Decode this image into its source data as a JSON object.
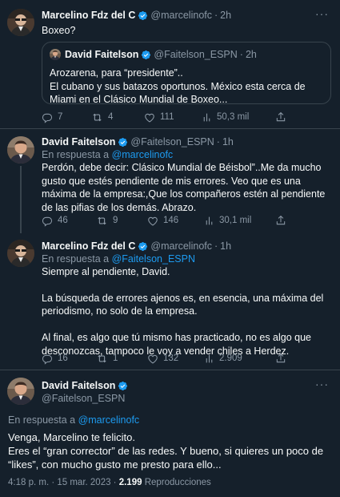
{
  "tweets": [
    {
      "name": "Marcelino Fdz del C",
      "handle": "@marcelinofc",
      "time": "2h",
      "text": "Boxeo?",
      "quote": {
        "name": "David Faitelson",
        "handle": "@Faitelson_ESPN",
        "time": "2h",
        "lines": [
          "Arozarena, para “presidente”..",
          "El cubano y sus batazos oportunos. México esta cerca de Miami en el Clásico Mundial de Boxeo..."
        ]
      },
      "actions": {
        "replies": "7",
        "retweets": "4",
        "likes": "111",
        "views": "50,3 mil"
      }
    },
    {
      "name": "David Faitelson",
      "handle": "@Faitelson_ESPN",
      "time": "1h",
      "reply_prefix": "En respuesta a",
      "reply_to": "@marcelinofc",
      "text": "Perdón, debe decir: Clásico Mundial de Béisbol”..Me da mucho gusto que estés pendiente de mis errores. Veo que es una máxima de la empresa:,Que los  compañeros estén al pendiente de las pifias de los demás. Abrazo.",
      "actions": {
        "replies": "46",
        "retweets": "9",
        "likes": "146",
        "views": "30,1 mil"
      }
    },
    {
      "name": "Marcelino Fdz del C",
      "handle": "@marcelinofc",
      "time": "1h",
      "reply_prefix": "En respuesta a",
      "reply_to": "@Faitelson_ESPN",
      "paragraphs": [
        "Siempre al pendiente, David.",
        "La búsqueda de errores ajenos es, en esencia, una máxima del periodismo, no solo de la empresa.",
        "Al final, es algo que tú mismo has practicado, no es algo que desconozcas, tampoco le voy a vender chiles a Herdez."
      ],
      "actions": {
        "replies": "16",
        "retweets": "1",
        "likes": "132",
        "views": "2.909"
      }
    }
  ],
  "main": {
    "name": "David Faitelson",
    "handle": "@Faitelson_ESPN",
    "reply_prefix": "En respuesta a",
    "reply_to": "@marcelinofc",
    "lines": [
      "Venga, Marcelino te felicito.",
      "Eres el “gran corrector” de las redes. Y bueno, si quieres un poco de “likes”, con mucho gusto me presto para ello..."
    ],
    "timestamp": "4:18 p. m. · 15 mar. 2023 ·",
    "views_count": "2.199",
    "views_label": "Reproducciones"
  },
  "colors": {
    "background": "#15202b",
    "text": "#f7f9f9",
    "secondary": "#8b98a5",
    "link": "#1d9bf0",
    "verified": "#1d9bf0",
    "border": "#38444d"
  }
}
